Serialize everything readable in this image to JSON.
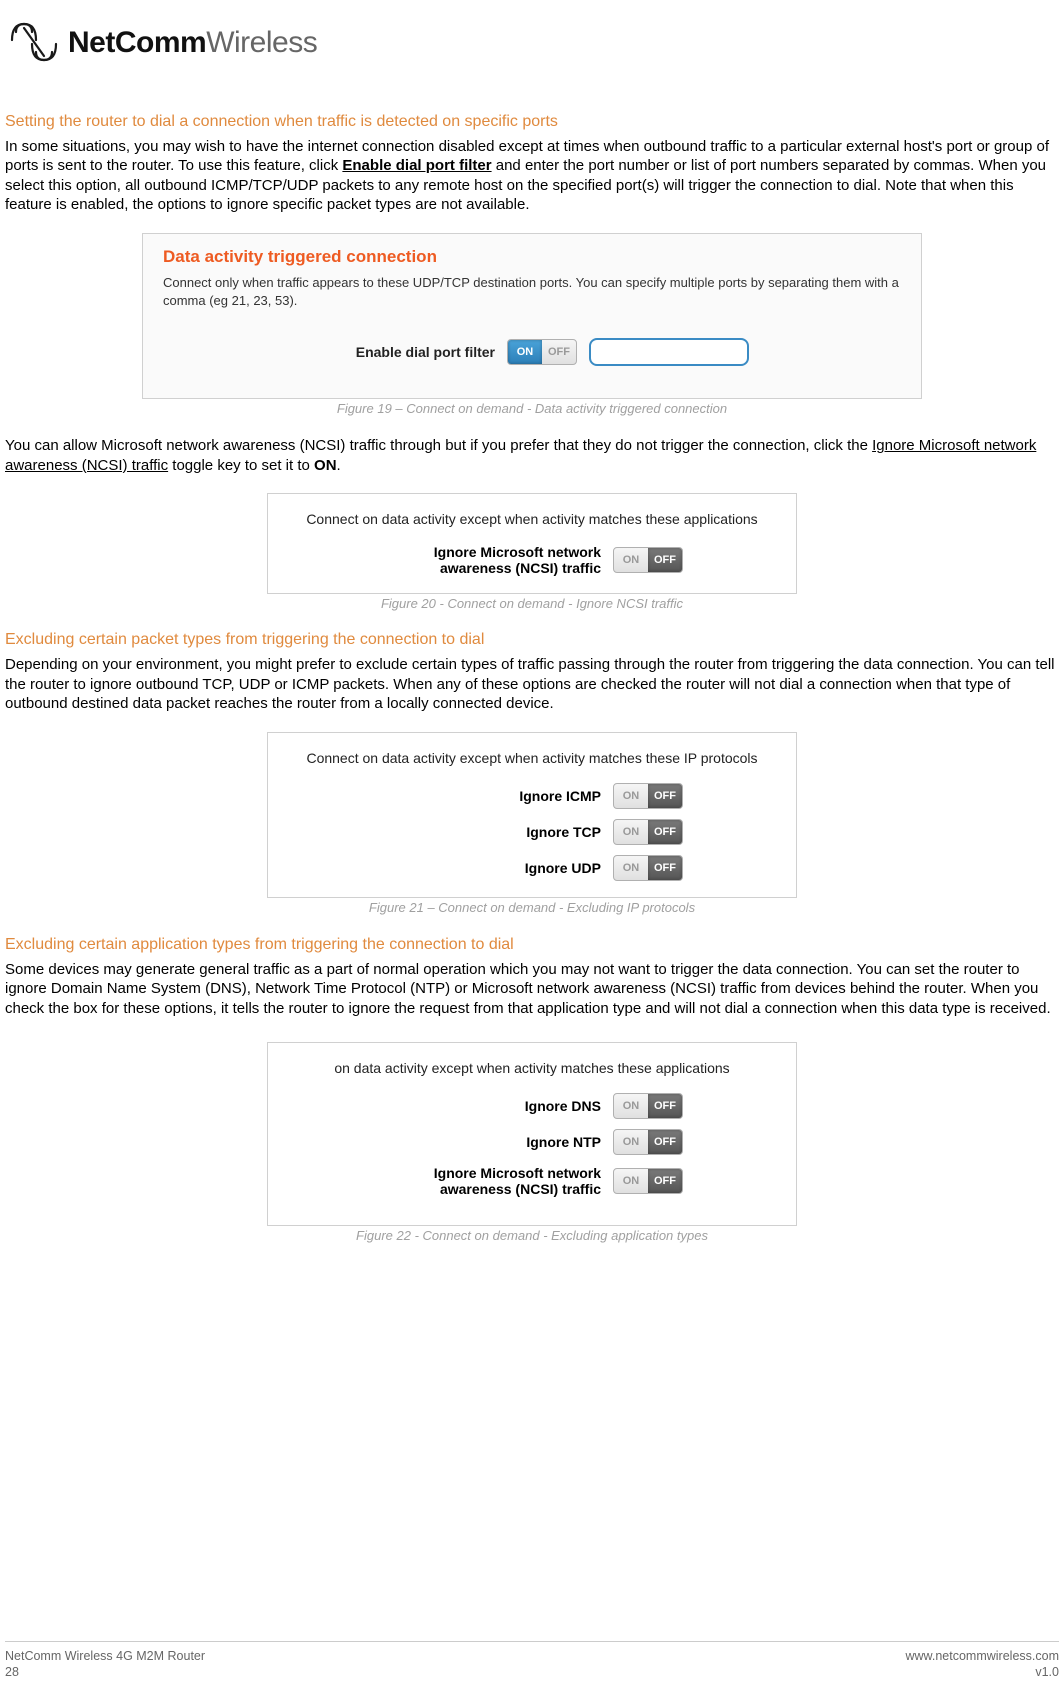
{
  "logo": {
    "brand_bold": "NetComm",
    "brand_thin": "Wireless"
  },
  "toggle_labels": {
    "on": "ON",
    "off": "OFF"
  },
  "section1": {
    "heading": "Setting the router to dial a connection when traffic is detected on specific ports",
    "p_a": "In some situations, you may wish to have the internet connection disabled except at times when outbound traffic to a particular external host's port or group of ports is sent to the router. To use this feature, click ",
    "p_bold": "Enable dial port filter",
    "p_b": " and enter the port number or list of port numbers separated by commas. When you select this option, all outbound ICMP/TCP/UDP packets to any remote host on the specified port(s) will trigger the connection to dial. Note that when this feature is enabled, the options to ignore specific packet types are not available."
  },
  "fig19": {
    "title": "Data activity triggered connection",
    "desc": "Connect only when traffic appears to these UDP/TCP destination ports. You can specify multiple ports by separating them with a comma (eg 21, 23, 53).",
    "label": "Enable dial port filter",
    "caption": "Figure 19 – Connect on demand - Data activity triggered connection"
  },
  "midpara": {
    "a": "You can allow Microsoft network awareness (NCSI) traffic through but if you prefer that they do not trigger the connection, click the ",
    "bold": "Ignore Microsoft network awareness (NCSI) traffic",
    "b": " toggle key to set it to ",
    "on": "ON",
    "c": "."
  },
  "fig20": {
    "header": "Connect on data activity except when activity matches these applications",
    "label": "Ignore Microsoft network awareness (NCSI) traffic",
    "caption": "Figure 20 - Connect on demand - Ignore NCSI traffic"
  },
  "section2": {
    "heading": "Excluding certain packet types from triggering the connection to dial",
    "p": "Depending on your environment, you might prefer to exclude certain types of traffic passing through the router from triggering the data connection. You can tell the router to ignore outbound TCP, UDP or ICMP packets. When any of these options are checked the router will not dial a connection when that type of outbound destined data packet reaches the router from a locally connected device."
  },
  "fig21": {
    "header": "Connect on data activity except when activity matches these IP protocols",
    "rows": [
      {
        "label": "Ignore ICMP"
      },
      {
        "label": "Ignore TCP"
      },
      {
        "label": "Ignore UDP"
      }
    ],
    "caption": "Figure 21 – Connect on demand - Excluding IP protocols"
  },
  "section3": {
    "heading": "Excluding certain application types from triggering the connection to dial",
    "p": "Some devices may generate general traffic as a part of normal operation which you may not want to trigger the data connection. You can set the router to ignore Domain Name System (DNS), Network Time Protocol (NTP) or Microsoft network awareness (NCSI) traffic from devices behind the router. When you check the box for these options, it tells the router to ignore the request from that application type and will not dial a connection when this data type is received."
  },
  "fig22": {
    "header": "on data activity except when activity matches these applications",
    "rows": [
      {
        "label": "Ignore DNS"
      },
      {
        "label": "Ignore NTP"
      },
      {
        "label": "Ignore Microsoft network awareness (NCSI) traffic"
      }
    ],
    "caption": "Figure 22 - Connect on demand - Excluding application types"
  },
  "footer": {
    "product": "NetComm Wireless 4G M2M Router",
    "page": "28",
    "url": "www.netcommwireless.com",
    "version": "v1.0"
  }
}
